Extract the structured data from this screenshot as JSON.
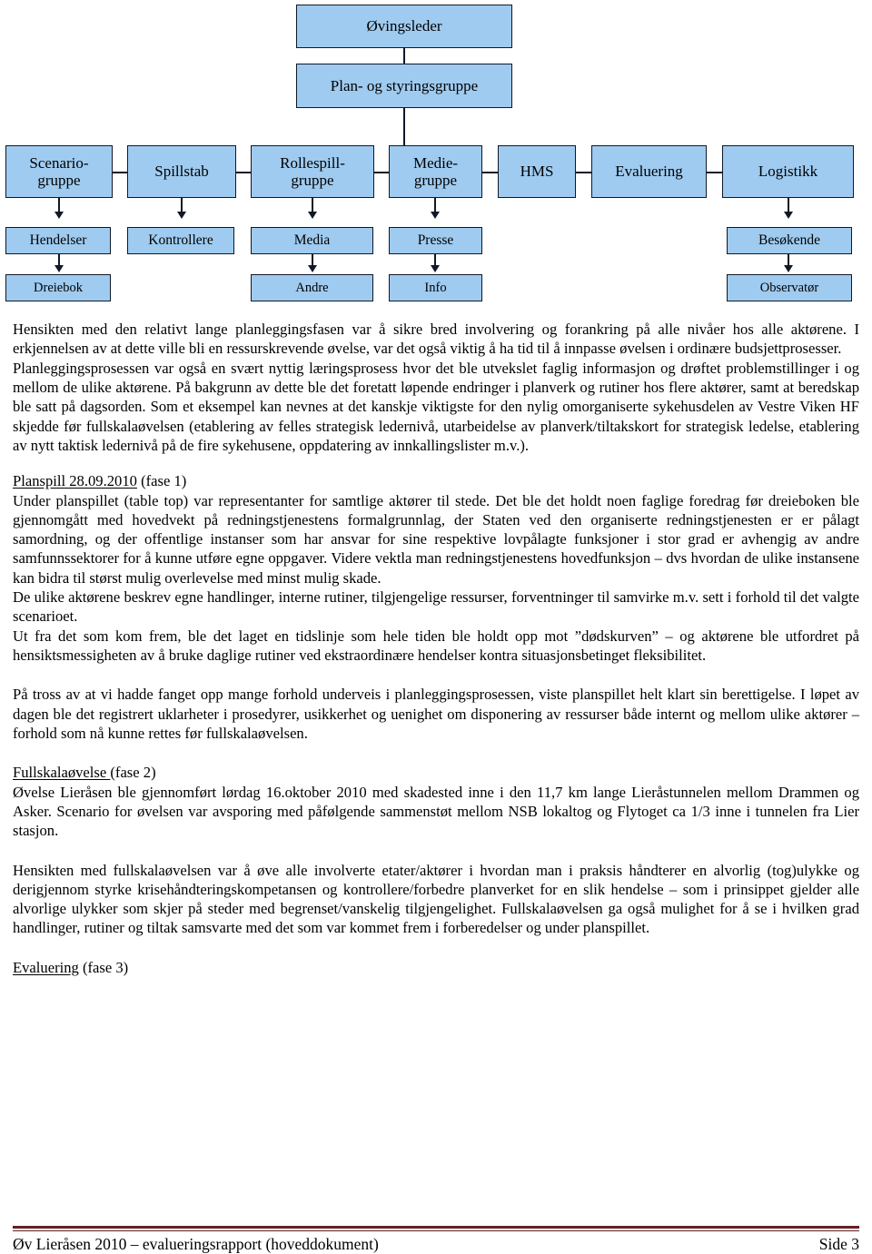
{
  "org_chart": {
    "title": "Exercise organisation chart",
    "box_fill_color": "#9FCBF0",
    "box_border_color": "#111827",
    "nodes": {
      "ovingsleder": "Øvingsleder",
      "plan_styringsgruppe": "Plan- og styringsgruppe",
      "scenariogruppe_line1": "Scenario-",
      "scenariogruppe_line2": "gruppe",
      "spillstab": "Spillstab",
      "rollespillgruppe_line1": "Rollespill-",
      "rollespillgruppe_line2": "gruppe",
      "mediegruppe_line1": "Medie-",
      "mediegruppe_line2": "gruppe",
      "hms": "HMS",
      "evaluering": "Evaluering",
      "logistikk": "Logistikk",
      "hendelser": "Hendelser",
      "kontrollere": "Kontrollere",
      "media": "Media",
      "presse": "Presse",
      "besokende": "Besøkende",
      "dreiebok": "Dreiebok",
      "andre": "Andre",
      "info": "Info",
      "observator": "Observatør"
    }
  },
  "body": {
    "p1": "Hensikten med den relativt lange planleggingsfasen var å sikre bred involvering og forankring på alle nivåer hos alle aktørene. I erkjennelsen av at dette ville bli en ressurskrevende øvelse, var det også viktig å ha tid til å innpasse øvelsen i ordinære budsjettprosesser.",
    "p2": "Planleggingsprosessen var også en svært nyttig læringsprosess hvor det ble utvekslet faglig informasjon og drøftet problemstillinger i og mellom de ulike aktørene. På bakgrunn av dette ble det foretatt løpende endringer i planverk og rutiner hos flere aktører, samt at beredskap ble satt på dagsorden. Som et eksempel kan nevnes at det kanskje viktigste for den nylig omorganiserte sykehusdelen av Vestre Viken HF skjedde før fullskalaøvelsen (etablering av felles strategisk ledernivå, utarbeidelse av planverk/tiltakskort for strategisk ledelse, etablering av nytt taktisk ledernivå på de fire sykehusene, oppdatering av innkallingslister m.v.).",
    "heading_planspill_underlined": "Planspill 28.09.2010",
    "heading_planspill_rest": " (fase 1)",
    "p3": "Under planspillet (table top) var representanter for samtlige aktører til stede. Det ble det holdt noen faglige foredrag før dreieboken ble gjennomgått med hovedvekt på redningstjenestens formalgrunnlag, der Staten ved den organiserte redningstjenesten er er pålagt samordning, og der offentlige instanser som har ansvar for sine respektive lovpålagte funksjoner i stor grad er avhengig av andre samfunnssektorer for å kunne utføre egne oppgaver. Videre vektla man redningstjenestens hovedfunksjon – dvs hvordan de ulike instansene kan bidra til størst mulig overlevelse med minst mulig skade.",
    "p4": "De ulike aktørene beskrev egne handlinger, interne rutiner, tilgjengelige ressurser, forventninger til samvirke m.v. sett i forhold til det valgte scenarioet.",
    "p5": "Ut fra det som kom frem, ble det laget en tidslinje som hele tiden ble holdt opp mot ”dødskurven” – og aktørene ble utfordret på hensiktsmessigheten av å bruke daglige rutiner ved ekstraordinære hendelser kontra situasjonsbetinget fleksibilitet.",
    "p6": "På tross av at vi hadde fanget opp mange forhold underveis i planleggingsprosessen, viste planspillet helt klart sin berettigelse. I løpet av dagen ble det registrert uklarheter i prosedyrer, usikkerhet og uenighet om disponering av ressurser både internt og mellom ulike aktører – forhold som nå kunne rettes før fullskalaøvelsen.",
    "heading_fullskala_underlined": "Fullskalaøvelse ",
    "heading_fullskala_rest": " (fase 2)",
    "p7": "Øvelse Lieråsen ble gjennomført lørdag 16.oktober 2010 med skadested inne i den 11,7 km lange Lieråstunnelen mellom Drammen og Asker. Scenario for øvelsen var avsporing med påfølgende sammenstøt mellom NSB lokaltog og Flytoget ca 1/3 inne i tunnelen fra Lier stasjon.",
    "p8": "Hensikten med fullskalaøvelsen var å øve alle involverte etater/aktører i hvordan man i praksis håndterer en alvorlig (tog)ulykke og derigjennom styrke krisehåndteringskompetansen og kontrollere/forbedre planverket for en slik hendelse – som i prinsippet gjelder alle alvorlige ulykker som skjer på steder med begrenset/vanskelig tilgjengelighet. Fullskalaøvelsen ga også mulighet for å se i hvilken grad handlinger, rutiner og tiltak samsvarte med det som var kommet frem i forberedelser og under planspillet.",
    "heading_evaluering_underlined": "Evaluering",
    "heading_evaluering_rest": " (fase 3)"
  },
  "footer": {
    "left": "Øv Lieråsen 2010 – evalueringsrapport (hoveddokument)",
    "right": "Side 3",
    "rule_color": "#622023"
  }
}
